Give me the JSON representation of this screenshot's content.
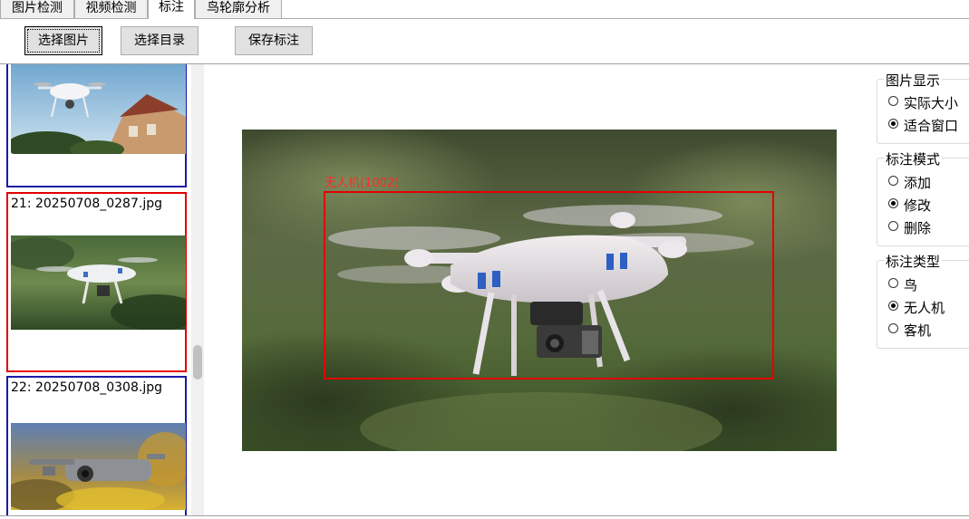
{
  "tabs": [
    {
      "label": "图片检测"
    },
    {
      "label": "视频检测"
    },
    {
      "label": "标注",
      "active": true
    },
    {
      "label": "鸟轮廓分析"
    }
  ],
  "toolbar": {
    "select_image": "选择图片",
    "select_dir": "选择目录",
    "save_annotation": "保存标注"
  },
  "list": {
    "items": [
      {
        "title": ""
      },
      {
        "title": "21: 20250708_0287.jpg"
      },
      {
        "title": "22: 20250708_0308.jpg"
      }
    ]
  },
  "viewer": {
    "annotation_label": "无人机(1002)"
  },
  "panel": {
    "display": {
      "title": "图片显示",
      "options": [
        "实际大小",
        "适合窗口"
      ],
      "selected": "适合窗口"
    },
    "mode": {
      "title": "标注模式",
      "options": [
        "添加",
        "修改",
        "删除"
      ],
      "selected": "修改"
    },
    "type": {
      "title": "标注类型",
      "options": [
        "鸟",
        "无人机",
        "客机"
      ],
      "selected": "无人机"
    }
  },
  "colors": {
    "bbox": "#e30000",
    "selected_card_border": "#e30000",
    "card_border": "#1a1aa8"
  }
}
